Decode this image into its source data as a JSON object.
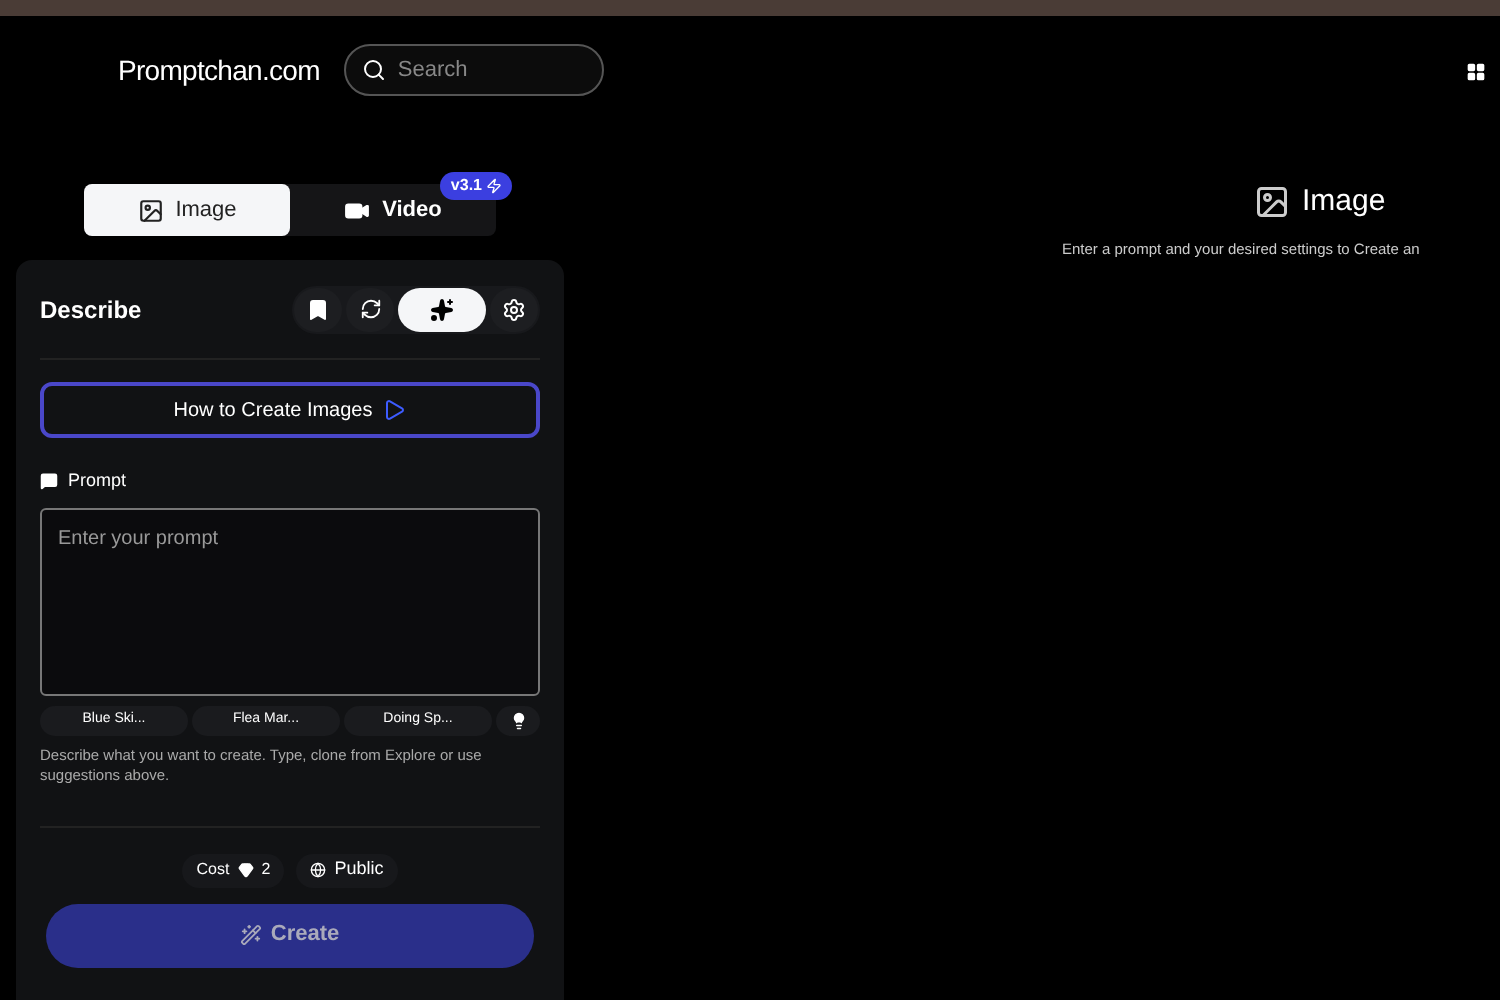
{
  "header": {
    "logo": "Promptchan.com",
    "search": {
      "placeholder": "Search"
    }
  },
  "mode_tabs": [
    {
      "label": "Image",
      "selected": true
    },
    {
      "label": "Video",
      "selected": false,
      "badge": "v3.1"
    }
  ],
  "panel": {
    "title": "Describe",
    "tools": [
      {
        "kind": "bookmark",
        "selected": false
      },
      {
        "kind": "refresh",
        "selected": false
      },
      {
        "kind": "sparkle",
        "selected": true
      },
      {
        "kind": "settings",
        "selected": false
      }
    ],
    "guide_button": "How to Create Images",
    "prompt": {
      "label": "Prompt",
      "placeholder": "Enter your prompt"
    },
    "suggestions": [
      "Blue Ski...",
      "Flea Mar...",
      "Doing Sp..."
    ],
    "help": "Describe what you want to create. Type, clone from Explore or use suggestions above.",
    "cost": {
      "label": "Cost",
      "value": "2"
    },
    "visibility": "Public",
    "create_button": "Create"
  },
  "preview": {
    "title": "Image",
    "subtitle": "Enter a prompt and your desired settings to Create an"
  }
}
